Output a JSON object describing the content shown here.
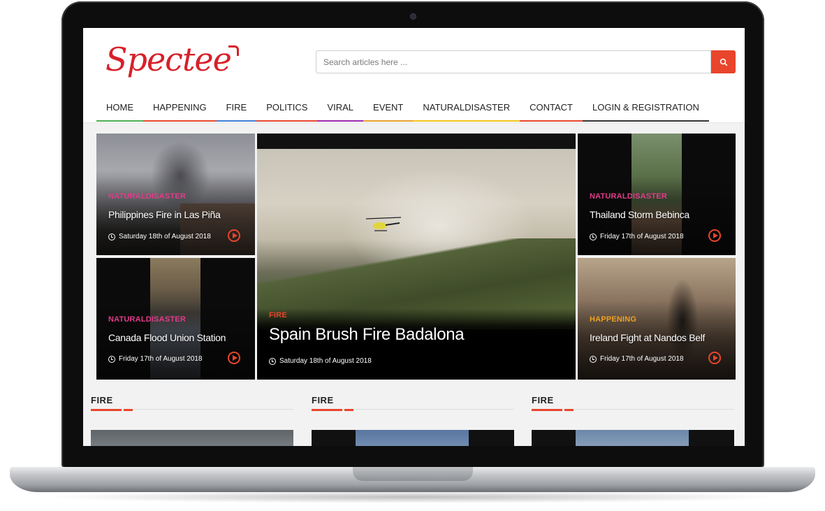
{
  "brand": {
    "name": "Spectee",
    "color": "#d7202a"
  },
  "search": {
    "placeholder": "Search articles here ...",
    "button_icon": "search-icon"
  },
  "nav": {
    "items": [
      {
        "label": "HOME",
        "underline": "#4caf50"
      },
      {
        "label": "HAPPENING",
        "underline": "#e8452c"
      },
      {
        "label": "FIRE",
        "underline": "#3f7fd6"
      },
      {
        "label": "POLITICS",
        "underline": "#e8452c"
      },
      {
        "label": "VIRAL",
        "underline": "#9c27b0"
      },
      {
        "label": "EVENT",
        "underline": "#e8a22c"
      },
      {
        "label": "NATURALDISASTER",
        "underline": "#f0c419"
      },
      {
        "label": "CONTACT",
        "underline": "#e8452c"
      },
      {
        "label": "LOGIN & REGISTRATION",
        "underline": "#333333"
      }
    ]
  },
  "hero": {
    "featured": {
      "category": "FIRE",
      "title": "Spain Brush Fire Badalona",
      "date": "Saturday 18th of August 2018"
    },
    "tiles": [
      {
        "category": "NATURALDISASTER",
        "title": "Philippines Fire in Las Piña",
        "date": "Saturday 18th of August 2018"
      },
      {
        "category": "NATURALDISASTER",
        "title": "Canada Flood Union Station",
        "date": "Friday 17th of August 2018"
      },
      {
        "category": "NATURALDISASTER",
        "title": "Thailand Storm Bebinca",
        "date": "Friday 17th of August 2018"
      },
      {
        "category": "HAPPENING",
        "title": "Ireland Fight at Nandos Belf",
        "date": "Friday 17th of August 2018"
      }
    ]
  },
  "sections": [
    {
      "title": "FIRE"
    },
    {
      "title": "FIRE"
    },
    {
      "title": "FIRE"
    }
  ],
  "colors": {
    "accent": "#e8452c",
    "naturaldisaster": "#e23b8a",
    "happening": "#f0a21a",
    "fire": "#e8452c"
  }
}
